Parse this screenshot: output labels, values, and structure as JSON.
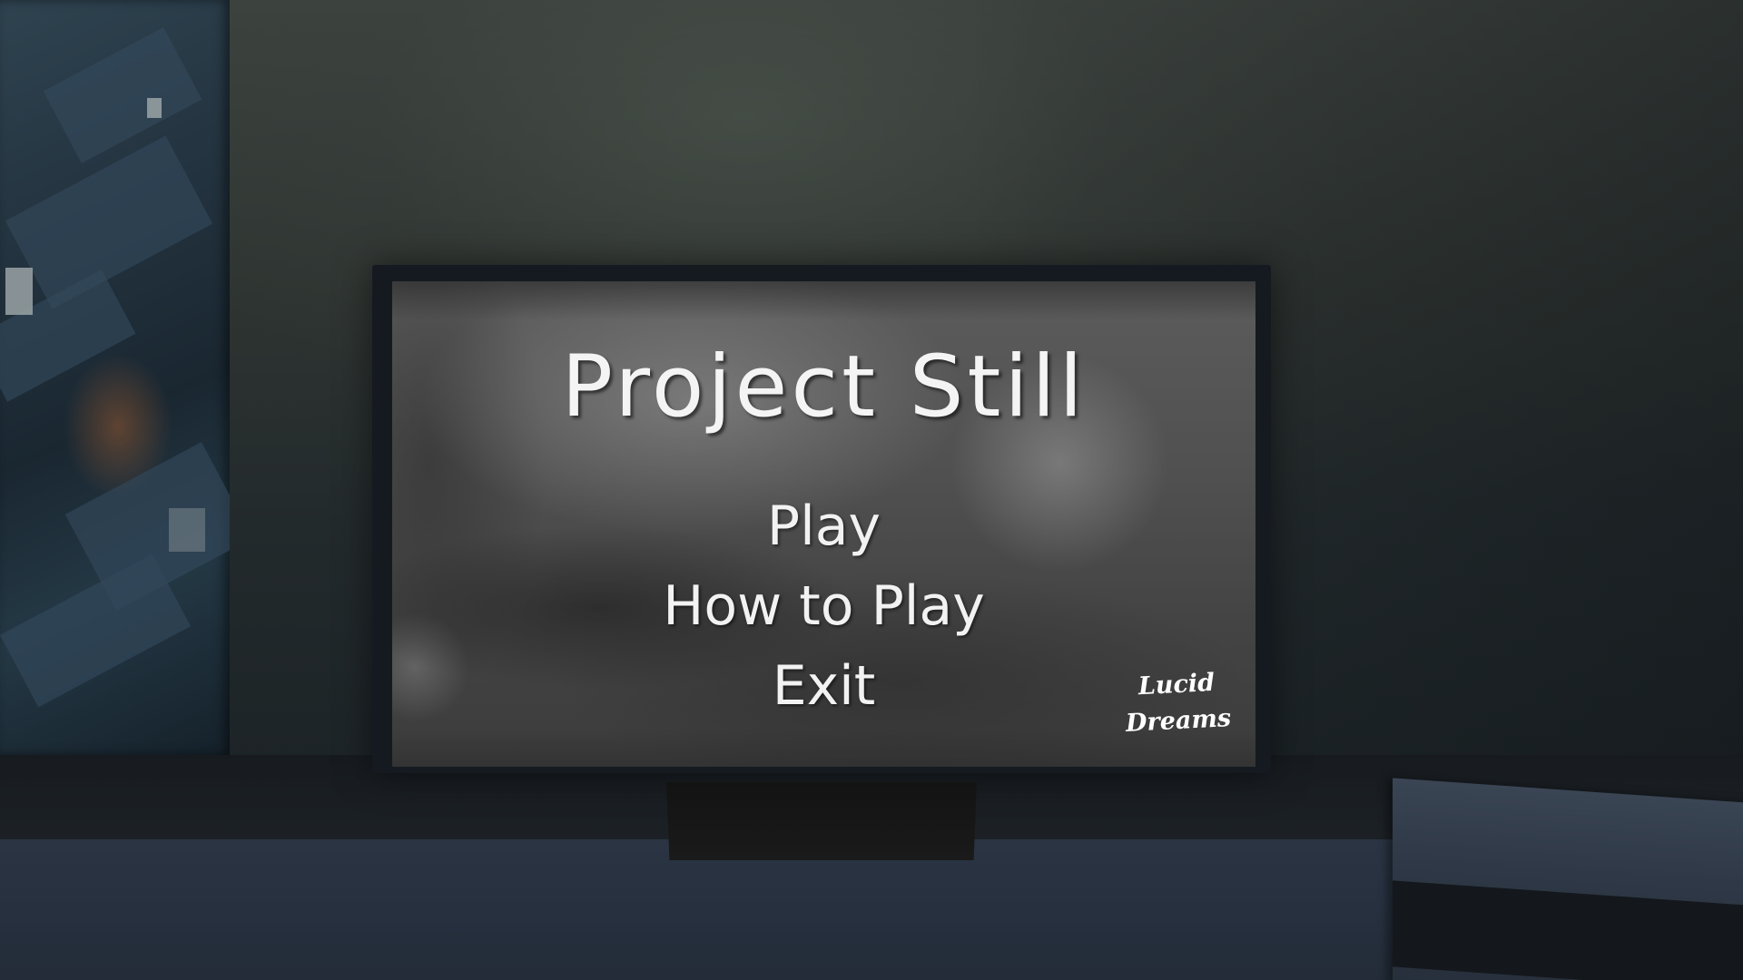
{
  "game": {
    "title": "Project Still"
  },
  "main_menu": {
    "items": [
      {
        "label": "Play"
      },
      {
        "label": "How to Play"
      },
      {
        "label": "Exit"
      }
    ]
  },
  "studio_logo": {
    "line1": "Lucid",
    "line2": "Dreams"
  },
  "colors": {
    "menu_text": "#f2f2f2",
    "screen_bg": "#505050",
    "wall": "#2e3431"
  }
}
